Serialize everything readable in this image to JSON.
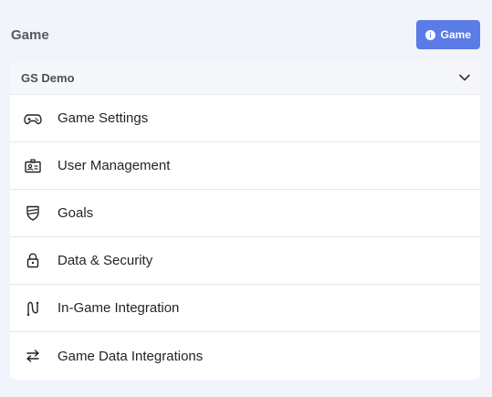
{
  "header": {
    "title": "Game",
    "game_button_label": "Game"
  },
  "panel": {
    "title": "GS Demo",
    "items": [
      {
        "label": "Game Settings",
        "icon": "gamepad-icon"
      },
      {
        "label": "User Management",
        "icon": "id-card-icon"
      },
      {
        "label": "Goals",
        "icon": "shield-icon"
      },
      {
        "label": "Data & Security",
        "icon": "lock-icon"
      },
      {
        "label": "In-Game Integration",
        "icon": "route-icon"
      },
      {
        "label": "Game Data Integrations",
        "icon": "arrows-exchange-icon"
      }
    ]
  },
  "colors": {
    "background": "#f2f4fb",
    "accent": "#5b7ce6",
    "panel": "#ffffff"
  }
}
